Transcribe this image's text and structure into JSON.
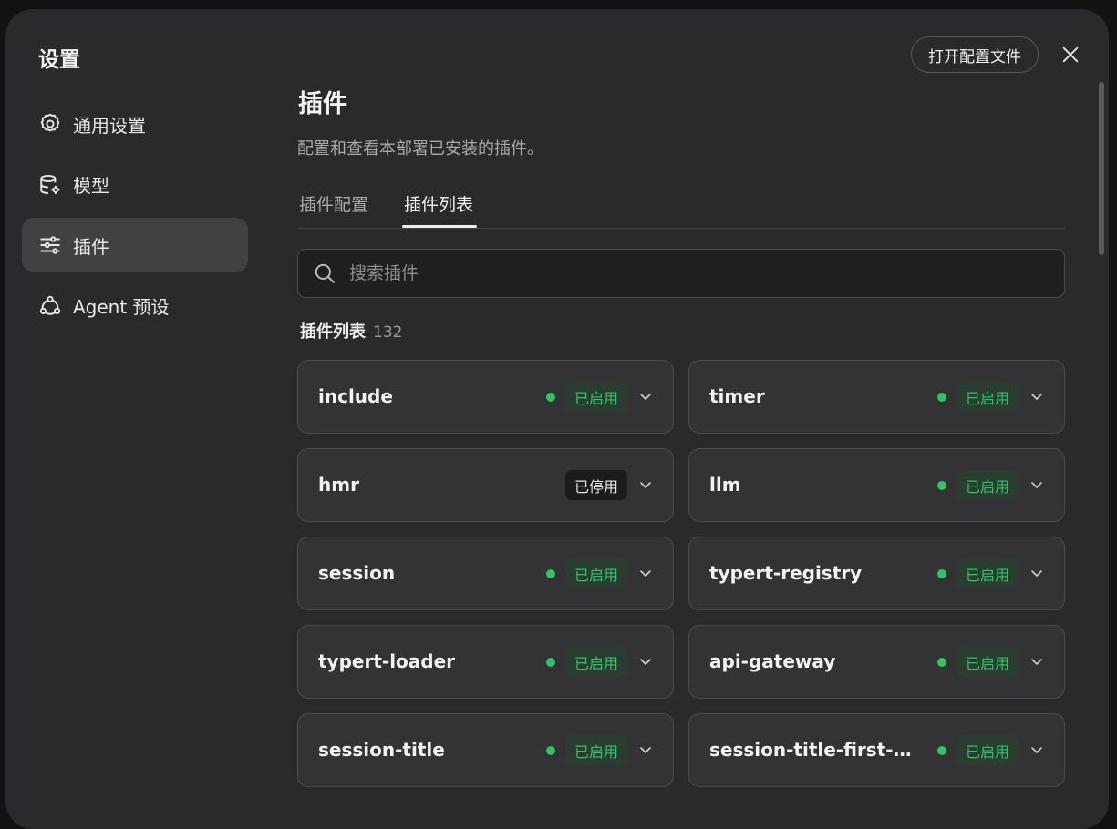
{
  "sidebar": {
    "title": "设置",
    "items": [
      {
        "label": "通用设置",
        "icon": "gear-icon"
      },
      {
        "label": "模型",
        "icon": "database-icon"
      },
      {
        "label": "插件",
        "icon": "sliders-icon"
      },
      {
        "label": "Agent 预设",
        "icon": "agent-icon"
      }
    ]
  },
  "header": {
    "open_config_label": "打开配置文件",
    "close_icon": "close-icon"
  },
  "page": {
    "title": "插件",
    "description": "配置和查看本部署已安装的插件。",
    "tabs": [
      {
        "label": "插件配置"
      },
      {
        "label": "插件列表"
      }
    ]
  },
  "search": {
    "placeholder": "搜索插件"
  },
  "plugin_list": {
    "title": "插件列表",
    "count": "132",
    "plugins": [
      {
        "name": "include",
        "status": "已启用"
      },
      {
        "name": "timer",
        "status": "已启用"
      },
      {
        "name": "hmr",
        "status": "已停用"
      },
      {
        "name": "llm",
        "status": "已启用"
      },
      {
        "name": "session",
        "status": "已启用"
      },
      {
        "name": "typert-registry",
        "status": "已启用"
      },
      {
        "name": "typert-loader",
        "status": "已启用"
      },
      {
        "name": "api-gateway",
        "status": "已启用"
      },
      {
        "name": "session-title",
        "status": "已启用"
      },
      {
        "name": "session-title-first-m...",
        "status": "已启用"
      }
    ]
  },
  "colors": {
    "enabled_green": "#2fc468",
    "window_bg": "#2a2a2c",
    "active_item_bg": "#414143"
  }
}
